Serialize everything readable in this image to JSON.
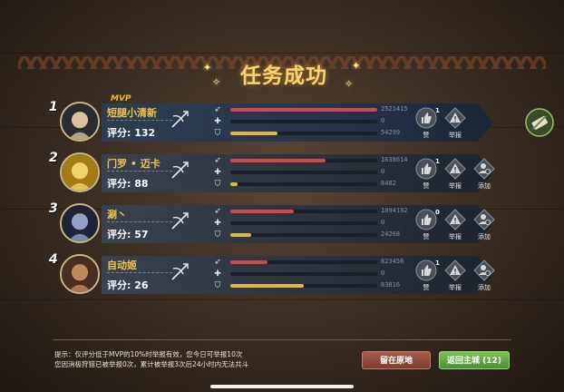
{
  "title": "任务成功",
  "mvp_label": "MVP",
  "score_prefix": "评分: ",
  "players": [
    {
      "rank": "1",
      "name": "短腿小清新",
      "score": "132",
      "damage": "2521415",
      "damage_frac": 1.0,
      "heal": "0",
      "heal_frac": 0.0,
      "tank": "54299",
      "tank_frac": 0.32,
      "likes": "1",
      "mvp": true,
      "like_label": "赞",
      "report_label": "举报",
      "add_label": ""
    },
    {
      "rank": "2",
      "name": "门罗 • 迈卡",
      "score": "88",
      "damage": "1638614",
      "damage_frac": 0.65,
      "heal": "0",
      "heal_frac": 0.0,
      "tank": "8482",
      "tank_frac": 0.05,
      "likes": "1",
      "mvp": false,
      "like_label": "赞",
      "report_label": "举报",
      "add_label": "添加"
    },
    {
      "rank": "3",
      "name": "涮丶",
      "score": "57",
      "damage": "1094192",
      "damage_frac": 0.43,
      "heal": "0",
      "heal_frac": 0.0,
      "tank": "24268",
      "tank_frac": 0.14,
      "likes": "0",
      "mvp": false,
      "like_label": "赞",
      "report_label": "举报",
      "add_label": "添加"
    },
    {
      "rank": "4",
      "name": "自动姬",
      "score": "26",
      "damage": "623456",
      "damage_frac": 0.25,
      "heal": "0",
      "heal_frac": 0.0,
      "tank": "83816",
      "tank_frac": 0.5,
      "likes": "1",
      "mvp": false,
      "like_label": "赞",
      "report_label": "举报",
      "add_label": "添加"
    }
  ],
  "tip_line1": "提示：仅评分低于MVP的10%时举报有效，您今日可举报10次",
  "tip_line2": "您因消极狩猎已被举报0次，累计被举报3次后24小时内无法共斗",
  "stay_button": "留在原地",
  "back_button": "返回主城 (12)",
  "colors": {
    "damage": "#d0484a",
    "heal": "#9fbf6a",
    "tank": "#e2b545",
    "title": "#f6d477",
    "name": "#f1c14a"
  },
  "icons": {
    "damage": "rocket-icon",
    "heal": "plus-icon",
    "tank": "shield-icon",
    "weapon": "crossbow-icon",
    "like": "thumbs-up-icon",
    "report": "warning-icon",
    "add": "add-friend-icon",
    "share": "share-icon"
  }
}
